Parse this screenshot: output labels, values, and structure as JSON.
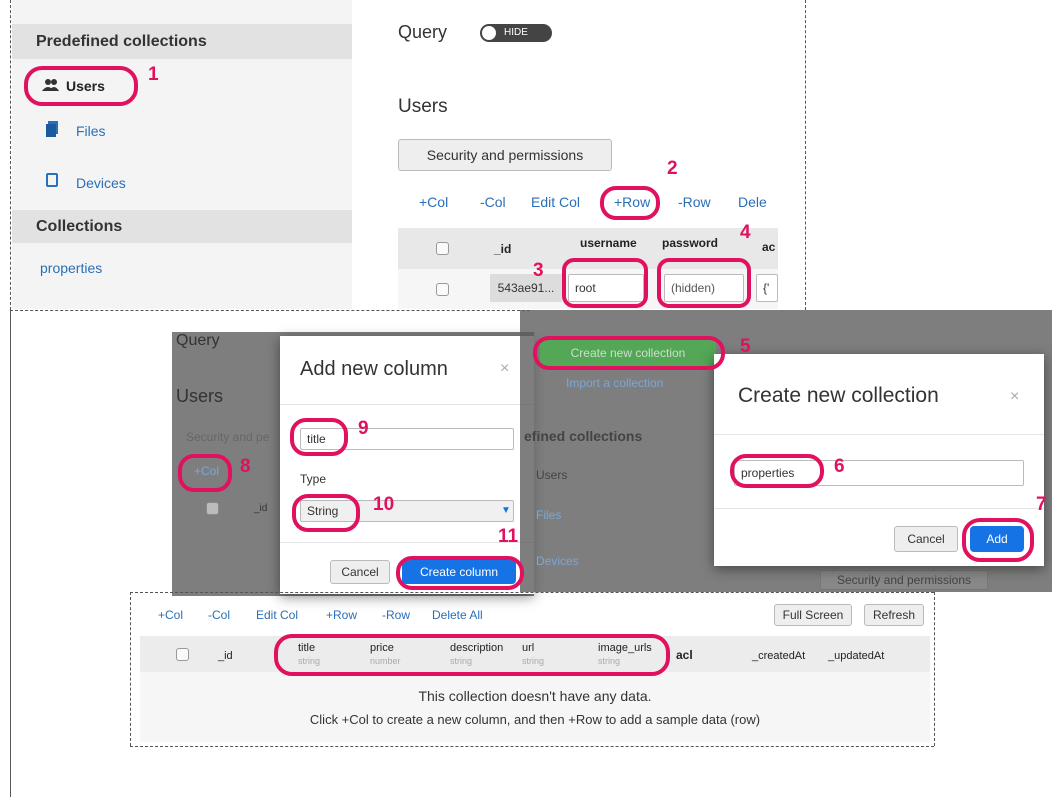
{
  "sidebar": {
    "predefined_header": "Predefined collections",
    "items": [
      {
        "label": "Users",
        "icon": "users-icon"
      },
      {
        "label": "Files",
        "icon": "files-icon"
      },
      {
        "label": "Devices",
        "icon": "device-icon"
      }
    ],
    "collections_header": "Collections",
    "collections": [
      "properties"
    ]
  },
  "main": {
    "query_label": "Query",
    "query_toggle": "HIDE",
    "title": "Users",
    "security_button": "Security and permissions",
    "toolbar": [
      "+Col",
      "-Col",
      "Edit Col",
      "+Row",
      "-Row",
      "Dele"
    ],
    "table": {
      "headers": [
        "_id",
        "username",
        "password",
        "ac"
      ],
      "row": {
        "id": "543ae91...",
        "username": "root",
        "password": "(hidden)",
        "acl": "{'"
      }
    }
  },
  "add_column_dialog": {
    "bg_query": "Query",
    "bg_title": "Users",
    "bg_security": "Security and pe",
    "bg_col": "+Col",
    "bg_id": "_id",
    "title": "Add new column",
    "close": "×",
    "name_value": "title",
    "type_label": "Type",
    "type_value": "String",
    "cancel": "Cancel",
    "create": "Create column"
  },
  "create_collection_dialog": {
    "bg_create_button": "Create new collection",
    "bg_import": "Import a collection",
    "bg_predefined": "efined collections",
    "bg_users": "Users",
    "bg_files": "Files",
    "bg_devices": "Devices",
    "bg_security": "Security and permissions",
    "title": "Create new collection",
    "close": "×",
    "name_value": "properties",
    "cancel": "Cancel",
    "add": "Add"
  },
  "result_panel": {
    "toolbar": [
      "+Col",
      "-Col",
      "Edit Col",
      "+Row",
      "-Row",
      "Delete All"
    ],
    "full_screen": "Full Screen",
    "refresh": "Refresh",
    "columns": [
      {
        "name": "_id",
        "type": ""
      },
      {
        "name": "title",
        "type": "string"
      },
      {
        "name": "price",
        "type": "number"
      },
      {
        "name": "description",
        "type": "string"
      },
      {
        "name": "url",
        "type": "string"
      },
      {
        "name": "image_urls",
        "type": "string"
      },
      {
        "name": "acl",
        "type": ""
      },
      {
        "name": "_createdAt",
        "type": ""
      },
      {
        "name": "_updatedAt",
        "type": ""
      }
    ],
    "empty_line1": "This collection doesn't have any data.",
    "empty_line2": "Click +Col to create a new column, and then +Row to add a sample data (row)"
  },
  "callouts": [
    "1",
    "2",
    "3",
    "4",
    "5",
    "6",
    "7",
    "8",
    "9",
    "10",
    "11"
  ],
  "colors": {
    "accent": "#e0115f",
    "link": "#2a6fb8",
    "primary_button": "#1673e6",
    "green_button": "#4caf50"
  }
}
